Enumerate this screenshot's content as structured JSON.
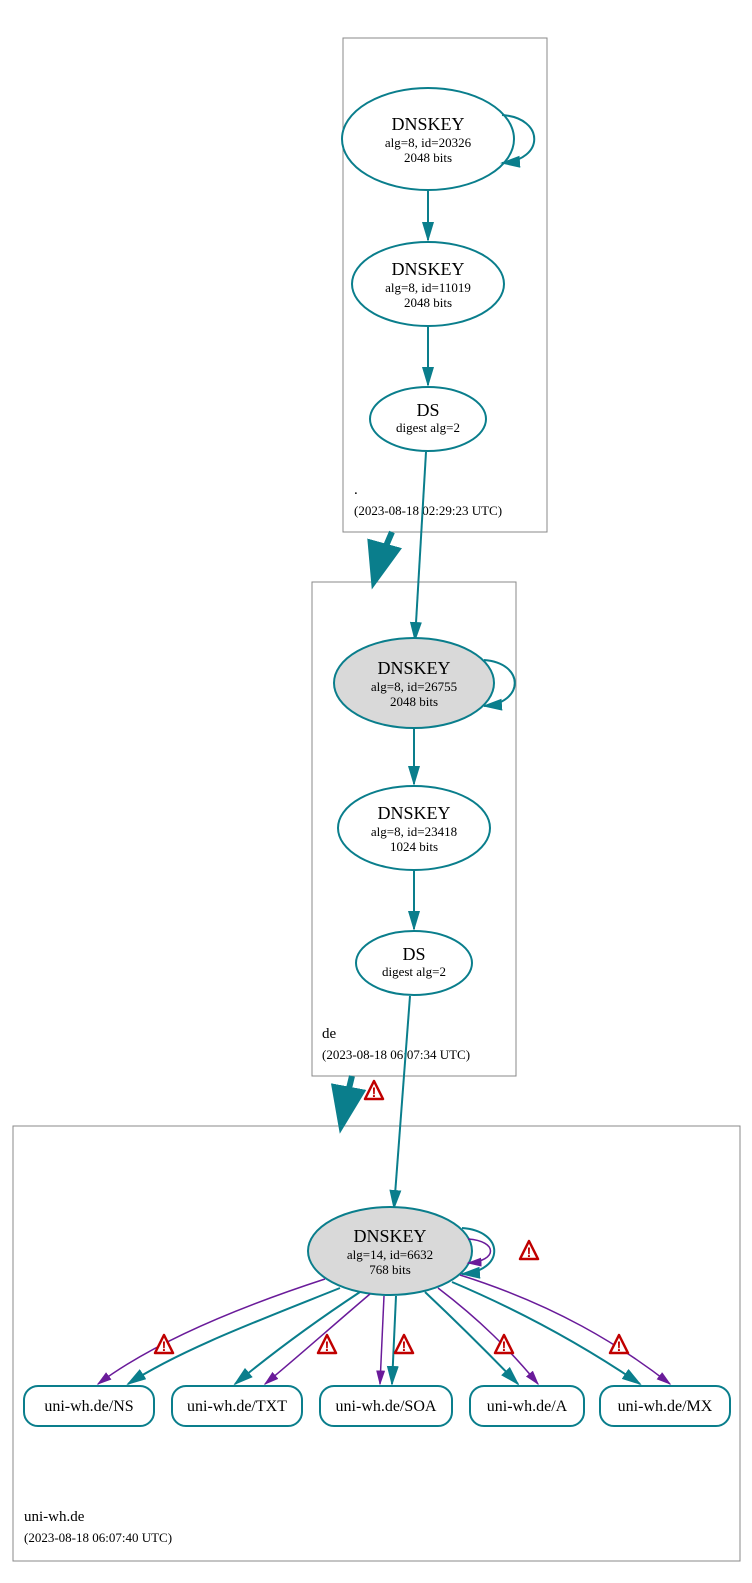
{
  "zones": {
    "root": {
      "label": ".",
      "time": "(2023-08-18 02:29:23 UTC)"
    },
    "de": {
      "label": "de",
      "time": "(2023-08-18 06:07:34 UTC)"
    },
    "uni": {
      "label": "uni-wh.de",
      "time": "(2023-08-18 06:07:40 UTC)"
    }
  },
  "nodes": {
    "root_ksk": {
      "t": "DNSKEY",
      "l1": "alg=8, id=20326",
      "l2": "2048 bits"
    },
    "root_zsk": {
      "t": "DNSKEY",
      "l1": "alg=8, id=11019",
      "l2": "2048 bits"
    },
    "root_ds": {
      "t": "DS",
      "l1": "digest alg=2"
    },
    "de_ksk": {
      "t": "DNSKEY",
      "l1": "alg=8, id=26755",
      "l2": "2048 bits"
    },
    "de_zsk": {
      "t": "DNSKEY",
      "l1": "alg=8, id=23418",
      "l2": "1024 bits"
    },
    "de_ds": {
      "t": "DS",
      "l1": "digest alg=2"
    },
    "uni_key": {
      "t": "DNSKEY",
      "l1": "alg=14, id=6632",
      "l2": "768 bits"
    }
  },
  "records": {
    "ns": "uni-wh.de/NS",
    "txt": "uni-wh.de/TXT",
    "soa": "uni-wh.de/SOA",
    "a": "uni-wh.de/A",
    "mx": "uni-wh.de/MX"
  }
}
